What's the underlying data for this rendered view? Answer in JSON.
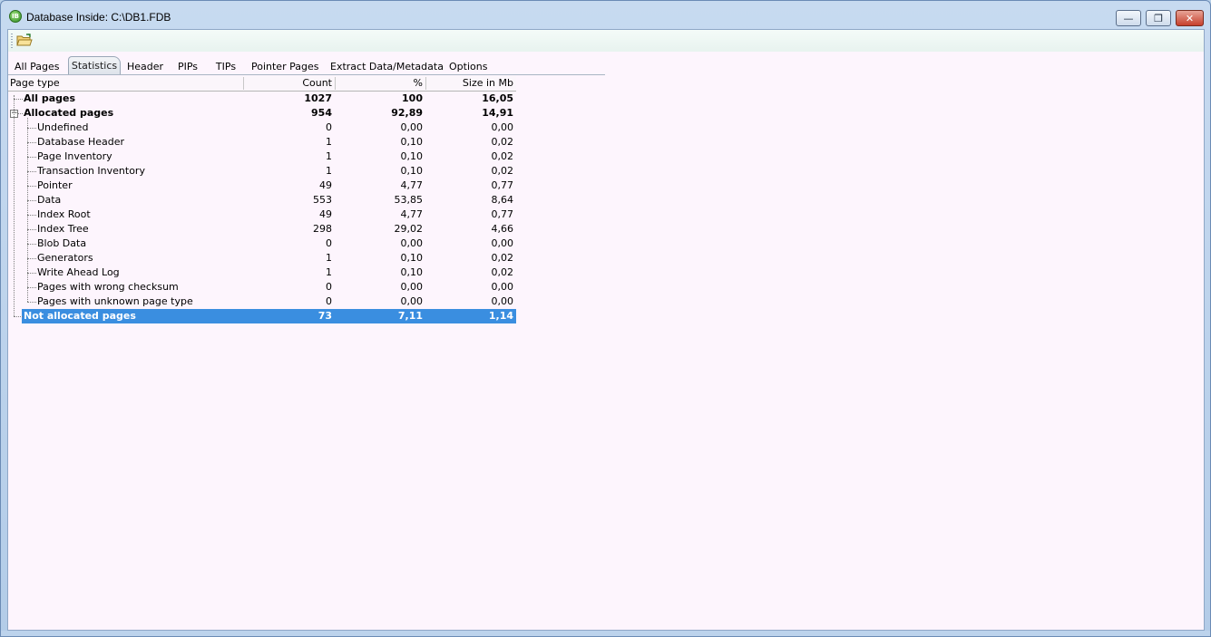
{
  "window": {
    "title": "Database Inside: C:\\DB1.FDB",
    "app_icon": "ib-logo-icon",
    "controls": {
      "minimize": "minimize-icon",
      "maximize": "restore-icon",
      "close": "close-icon"
    }
  },
  "toolbar": {
    "open_icon": "open-folder-icon"
  },
  "tabs": [
    {
      "label": "All Pages"
    },
    {
      "label": "Statistics"
    },
    {
      "label": "Header"
    },
    {
      "label": "PIPs"
    },
    {
      "label": "TIPs"
    },
    {
      "label": "Pointer Pages"
    },
    {
      "label": "Extract Data/Metadata"
    },
    {
      "label": "Options"
    }
  ],
  "active_tab": "Statistics",
  "grid": {
    "columns": [
      "Page type",
      "Count",
      "%",
      "Size in Mb"
    ],
    "rows": [
      {
        "label": "All pages",
        "count": "1027",
        "pct": "100",
        "size": "16,05",
        "level": 0,
        "bold": true
      },
      {
        "label": "Allocated pages",
        "count": "954",
        "pct": "92,89",
        "size": "14,91",
        "level": 0,
        "bold": true,
        "expanded": true
      },
      {
        "label": "Undefined",
        "count": "0",
        "pct": "0,00",
        "size": "0,00",
        "level": 1
      },
      {
        "label": "Database Header",
        "count": "1",
        "pct": "0,10",
        "size": "0,02",
        "level": 1
      },
      {
        "label": "Page Inventory",
        "count": "1",
        "pct": "0,10",
        "size": "0,02",
        "level": 1
      },
      {
        "label": "Transaction Inventory",
        "count": "1",
        "pct": "0,10",
        "size": "0,02",
        "level": 1
      },
      {
        "label": "Pointer",
        "count": "49",
        "pct": "4,77",
        "size": "0,77",
        "level": 1
      },
      {
        "label": "Data",
        "count": "553",
        "pct": "53,85",
        "size": "8,64",
        "level": 1
      },
      {
        "label": "Index Root",
        "count": "49",
        "pct": "4,77",
        "size": "0,77",
        "level": 1
      },
      {
        "label": "Index Tree",
        "count": "298",
        "pct": "29,02",
        "size": "4,66",
        "level": 1
      },
      {
        "label": "Blob Data",
        "count": "0",
        "pct": "0,00",
        "size": "0,00",
        "level": 1
      },
      {
        "label": "Generators",
        "count": "1",
        "pct": "0,10",
        "size": "0,02",
        "level": 1
      },
      {
        "label": "Write Ahead Log",
        "count": "1",
        "pct": "0,10",
        "size": "0,02",
        "level": 1
      },
      {
        "label": "Pages with wrong checksum",
        "count": "0",
        "pct": "0,00",
        "size": "0,00",
        "level": 1
      },
      {
        "label": "Pages with unknown page type",
        "count": "0",
        "pct": "0,00",
        "size": "0,00",
        "level": 1
      },
      {
        "label": "Not allocated pages",
        "count": "73",
        "pct": "7,11",
        "size": "1,14",
        "level": 0,
        "bold": true,
        "selected": true
      }
    ]
  },
  "colors": {
    "selection": "#3a8ee0",
    "client_background": "#fdf5fd",
    "toolbar_background": "#eef7f3",
    "frame": "#b9d1ea"
  }
}
